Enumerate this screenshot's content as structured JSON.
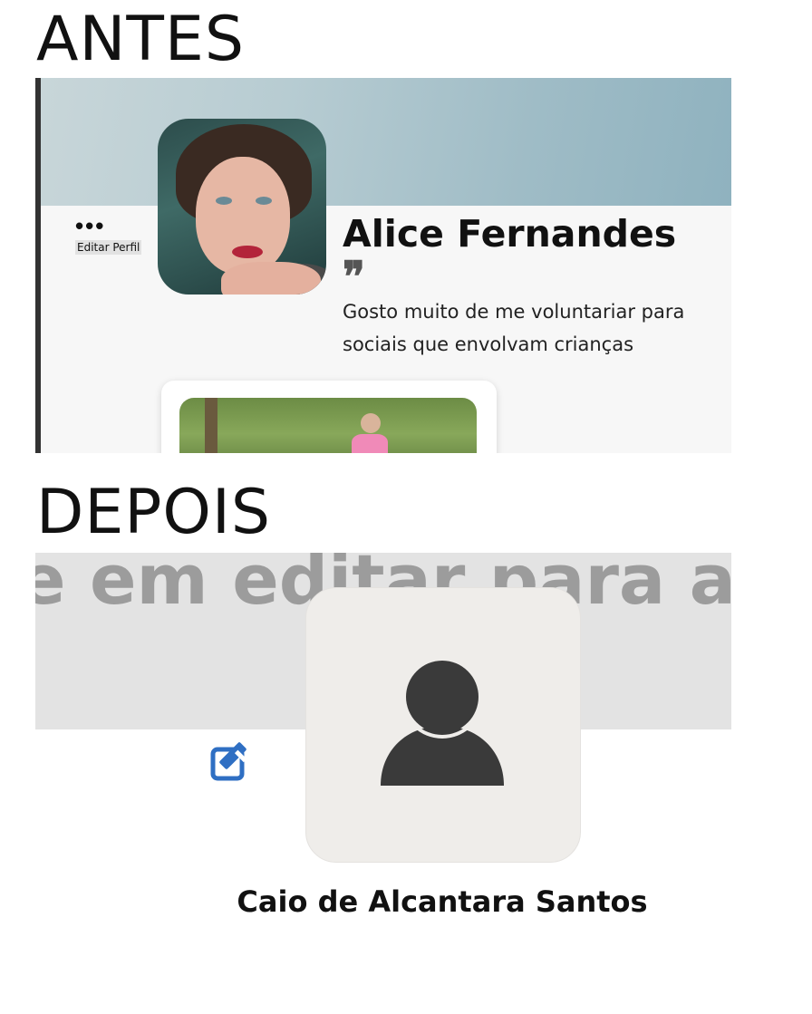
{
  "labels": {
    "before": "ANTES",
    "after": "DEPOIS"
  },
  "before": {
    "more_menu": "•••",
    "edit_profile": "Editar Perfil",
    "name": "Alice Fernandes",
    "quote_mark": "❞",
    "bio_line1": "Gosto muito de me voluntariar para",
    "bio_line2": "sociais que envolvam crianças"
  },
  "after": {
    "banner_hint": "e em editar para alte",
    "name": "Caio de Alcantara Santos",
    "icons": {
      "edit": "edit-icon",
      "avatar": "user-placeholder-icon"
    },
    "colors": {
      "edit_icon": "#2f6fc3",
      "avatar_fill": "#3a3a3a"
    }
  }
}
